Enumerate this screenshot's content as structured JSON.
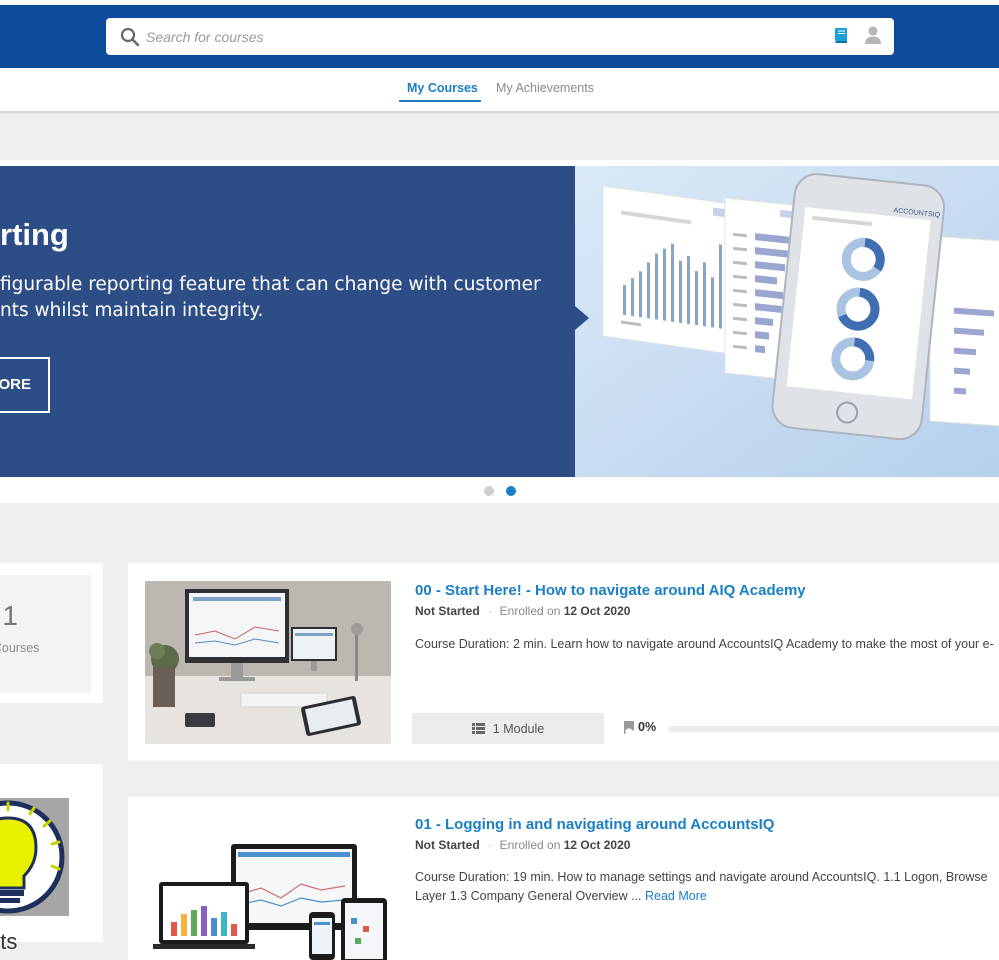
{
  "search": {
    "placeholder": "Search for courses"
  },
  "tabs": [
    {
      "label": "My Courses",
      "active": true
    },
    {
      "label": "My Achievements",
      "active": false
    }
  ],
  "banner": {
    "title_visible": "rting",
    "text_line1": "figurable reporting feature that can change with customer",
    "text_line2": "nts whilst maintain integrity.",
    "button_label": "ORE",
    "mock_logo_text": "ACCOUNTSIQ",
    "slides": 2,
    "active_slide": 2
  },
  "stats": {
    "count": "1",
    "label": "ted Courses"
  },
  "side_caption": "nts",
  "courses": [
    {
      "title": "00 - Start Here! - How to navigate around AIQ Academy",
      "status": "Not Started",
      "enrolled_prefix": "Enrolled on",
      "enrolled_date": "12 Oct 2020",
      "description": "Course Duration: 2 min. Learn how to navigate around AccountsIQ Academy to make the most of your e-",
      "read_more": "",
      "modules_label": "1 Module",
      "progress_label": "0%",
      "progress": 0
    },
    {
      "title": "01 - Logging in and navigating around AccountsIQ",
      "status": "Not Started",
      "enrolled_prefix": "Enrolled on",
      "enrolled_date": "12 Oct 2020",
      "description_line1": "Course Duration: 19 min.  How to manage settings and navigate around AccountsIQ.   1.1 Logon, Browse",
      "description_line2": "Layer 1.3 Company General Overview ...",
      "read_more": "Read More"
    }
  ],
  "colors": {
    "header_blue": "#0d4b9a",
    "accent": "#1a7fc4",
    "banner_blue": "#2c4d86",
    "banner_light": "#c9ddf1",
    "page_bg": "#efefef"
  },
  "icons": [
    "search-icon",
    "book-icon",
    "user-icon",
    "list-icon",
    "flag-icon",
    "lightbulb-icon"
  ]
}
